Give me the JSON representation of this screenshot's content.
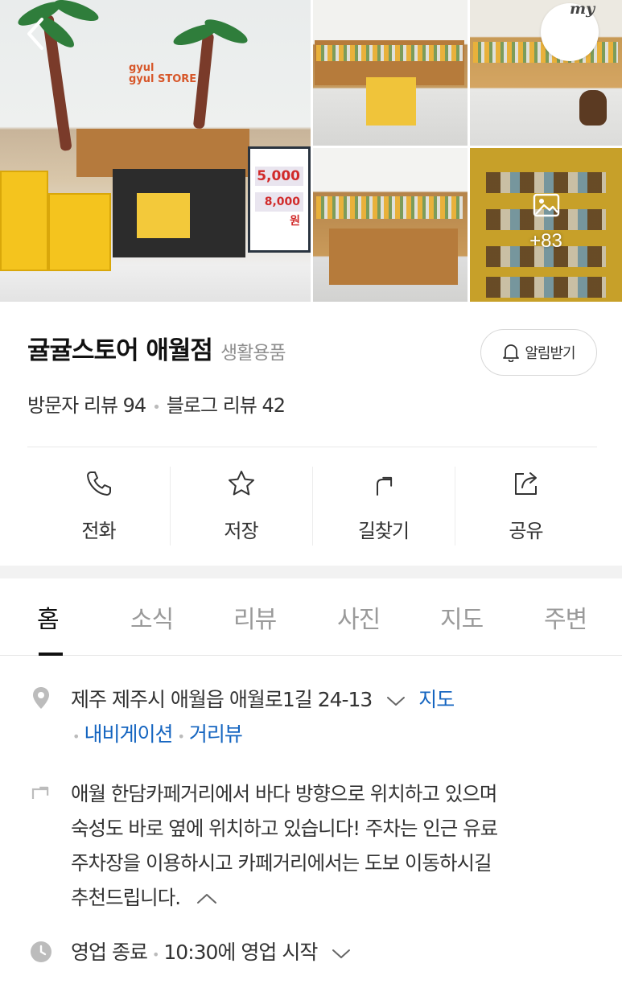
{
  "header": {
    "profile_badge": "my",
    "more_photos_count": "+83"
  },
  "gallery": {
    "logo_line1": "gyul",
    "logo_line2": "gyul STORE",
    "sign_price_1": "5,000",
    "sign_price_2": "8,000원"
  },
  "place": {
    "name": "귤귤스토어 애월점",
    "category": "생활용품",
    "alarm_label": "알림받기",
    "visitor_reviews": "방문자 리뷰 94",
    "blog_reviews": "블로그 리뷰 42"
  },
  "actions": [
    {
      "label": "전화",
      "icon": "phone-icon"
    },
    {
      "label": "저장",
      "icon": "star-icon"
    },
    {
      "label": "길찾기",
      "icon": "directions-icon"
    },
    {
      "label": "공유",
      "icon": "share-icon"
    }
  ],
  "tabs": [
    {
      "label": "홈",
      "active": true
    },
    {
      "label": "소식"
    },
    {
      "label": "리뷰"
    },
    {
      "label": "사진"
    },
    {
      "label": "지도"
    },
    {
      "label": "주변"
    }
  ],
  "info": {
    "address": "제주 제주시 애월읍 애월로1길 24-13",
    "map_link": "지도",
    "navigation_link": "내비게이션",
    "street_view_link": "거리뷰",
    "directions_desc": [
      "애월 한담카페거리에서 바다 방향으로 위치하고 있으며",
      "숙성도 바로 옆에 위치하고 있습니다! 주차는 인근 유료",
      "주차장을 이용하시고 카페거리에서는 도보 이동하시길",
      "추천드립니다."
    ],
    "status": "영업 종료",
    "open_time": "10:30에 영업 시작"
  },
  "colors": {
    "link": "#1565c0",
    "muted": "#9a9a9a",
    "text": "#333333"
  }
}
